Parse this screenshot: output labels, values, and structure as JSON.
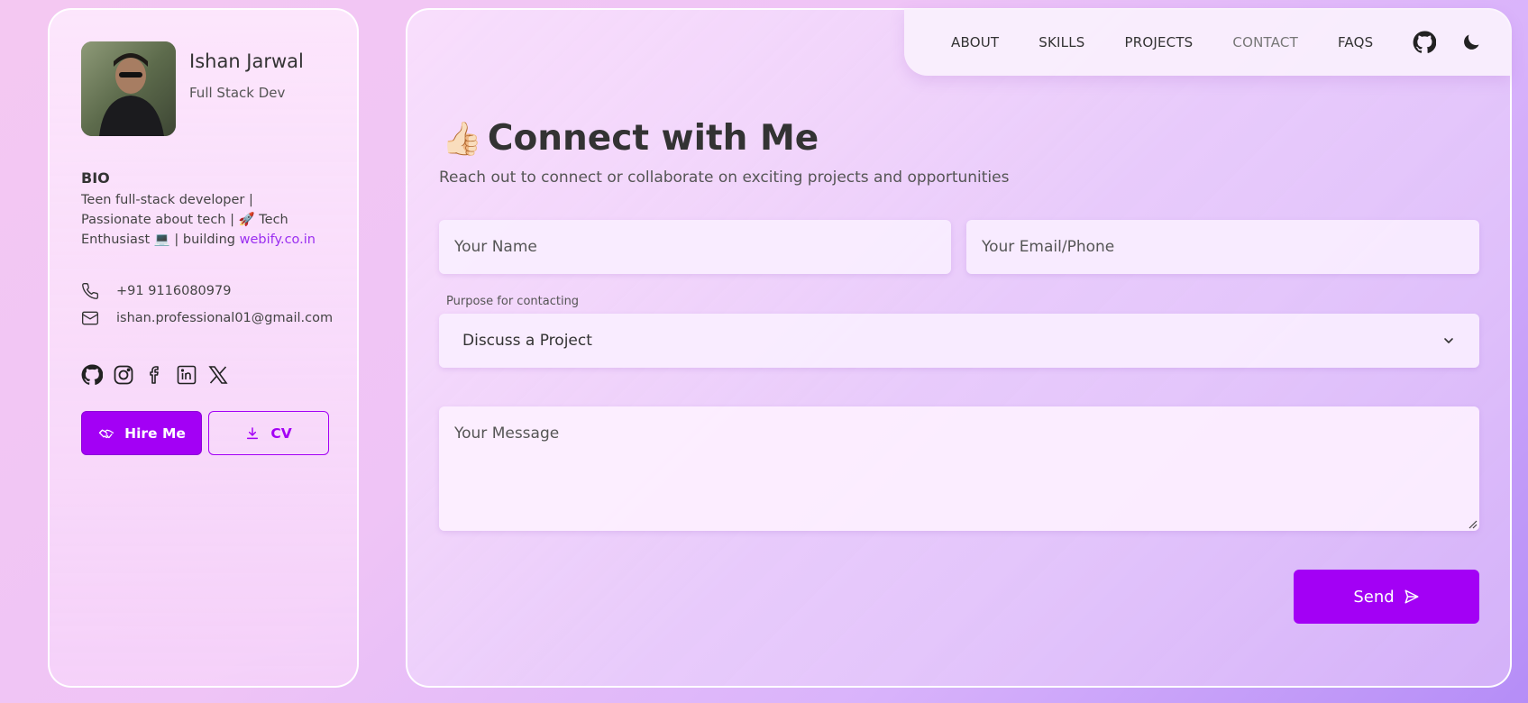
{
  "profile": {
    "name": "Ishan Jarwal",
    "role": "Full Stack Dev",
    "bio_title": "BIO",
    "bio_line1": "Teen full-stack developer |",
    "bio_line2": "Passionate about tech | 🚀 Tech",
    "bio_line3": "Enthusiast 💻 | building ",
    "bio_link": "webify.co.in",
    "phone": "+91 9116080979",
    "email": "ishan.professional01@gmail.com",
    "socials": [
      "github-icon",
      "instagram-icon",
      "facebook-icon",
      "linkedin-icon",
      "x-icon"
    ],
    "hire_label": "Hire Me",
    "cv_label": "CV"
  },
  "nav": {
    "items": [
      "ABOUT",
      "SKILLS",
      "PROJECTS",
      "CONTACT",
      "FAQS"
    ],
    "active": "CONTACT",
    "icons": [
      "github-icon",
      "moon-icon"
    ]
  },
  "contact": {
    "emoji": "👍🏻",
    "title": "Connect with Me",
    "subtitle": "Reach out to connect or collaborate on exciting projects and opportunities",
    "name_placeholder": "Your Name",
    "email_placeholder": "Your Email/Phone",
    "purpose_label": "Purpose for contacting",
    "purpose_value": "Discuss a Project",
    "message_placeholder": "Your Message",
    "send_label": "Send"
  },
  "colors": {
    "accent": "#a300f5",
    "link": "#9a2ef0"
  }
}
